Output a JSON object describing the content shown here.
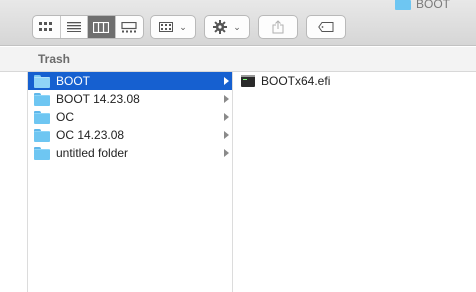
{
  "window": {
    "title": "BOOT"
  },
  "toolbar": {
    "view_buttons": [
      {
        "name": "icon-view",
        "icon": "grid-icon",
        "active": false
      },
      {
        "name": "list-view",
        "icon": "list-icon",
        "active": false
      },
      {
        "name": "column-view",
        "icon": "columns-icon",
        "active": true
      },
      {
        "name": "gallery-view",
        "icon": "gallery-icon",
        "active": false
      }
    ],
    "group_icon": "group-grid-icon",
    "action_icon": "gear-icon",
    "share_icon": "share-icon",
    "tags_icon": "tag-icon"
  },
  "pathbar": {
    "label": "Trash"
  },
  "column1": {
    "items": [
      {
        "label": "BOOT",
        "selected": true
      },
      {
        "label": "BOOT 14.23.08",
        "selected": false
      },
      {
        "label": "OC",
        "selected": false
      },
      {
        "label": "OC 14.23.08",
        "selected": false
      },
      {
        "label": "untitled folder",
        "selected": false
      }
    ]
  },
  "column2": {
    "items": [
      {
        "label": "BOOTx64.efi",
        "icon": "executable-icon"
      }
    ]
  },
  "colors": {
    "selection": "#1660d0",
    "folder": "#6ec6f2"
  }
}
